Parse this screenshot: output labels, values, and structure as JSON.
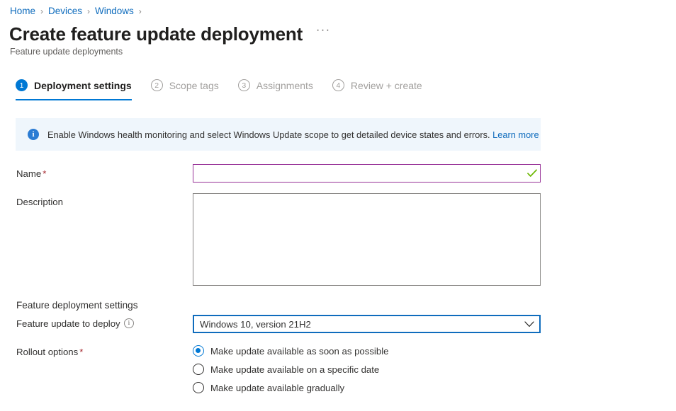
{
  "breadcrumb": {
    "items": [
      {
        "label": "Home"
      },
      {
        "label": "Devices"
      },
      {
        "label": "Windows"
      }
    ],
    "separator": "›"
  },
  "header": {
    "title": "Create feature update deployment",
    "subtitle": "Feature update deployments",
    "more_actions": "···"
  },
  "wizard": {
    "tabs": [
      {
        "number": "1",
        "label": "Deployment settings",
        "state": "active"
      },
      {
        "number": "2",
        "label": "Scope tags",
        "state": "inactive"
      },
      {
        "number": "3",
        "label": "Assignments",
        "state": "inactive"
      },
      {
        "number": "4",
        "label": "Review + create",
        "state": "inactive"
      }
    ]
  },
  "banner": {
    "icon": "info-icon",
    "icon_glyph": "i",
    "text": "Enable Windows health monitoring and select Windows Update scope to get detailed device states and errors.",
    "link_label": "Learn more",
    "background": "#eff6fc"
  },
  "form": {
    "name": {
      "label": "Name",
      "required_marker": "*",
      "value": "",
      "placeholder": "",
      "valid": true,
      "border_color": "#983298"
    },
    "description": {
      "label": "Description",
      "value": "",
      "placeholder": ""
    },
    "section_heading": "Feature deployment settings",
    "feature_update": {
      "label": "Feature update to deploy",
      "help_glyph": "i",
      "selected": "Windows 10, version 21H2",
      "options": [
        "Windows 10, version 21H2"
      ],
      "border_color": "#0f6cbd"
    },
    "rollout": {
      "label": "Rollout options",
      "required_marker": "*",
      "options": [
        {
          "label": "Make update available as soon as possible",
          "selected": true
        },
        {
          "label": "Make update available on a specific date",
          "selected": false
        },
        {
          "label": "Make update available gradually",
          "selected": false
        }
      ]
    }
  },
  "colors": {
    "accent": "#0078d4",
    "link": "#0f6cbd",
    "required": "#a4262c",
    "valid_check": "#6bb700"
  }
}
